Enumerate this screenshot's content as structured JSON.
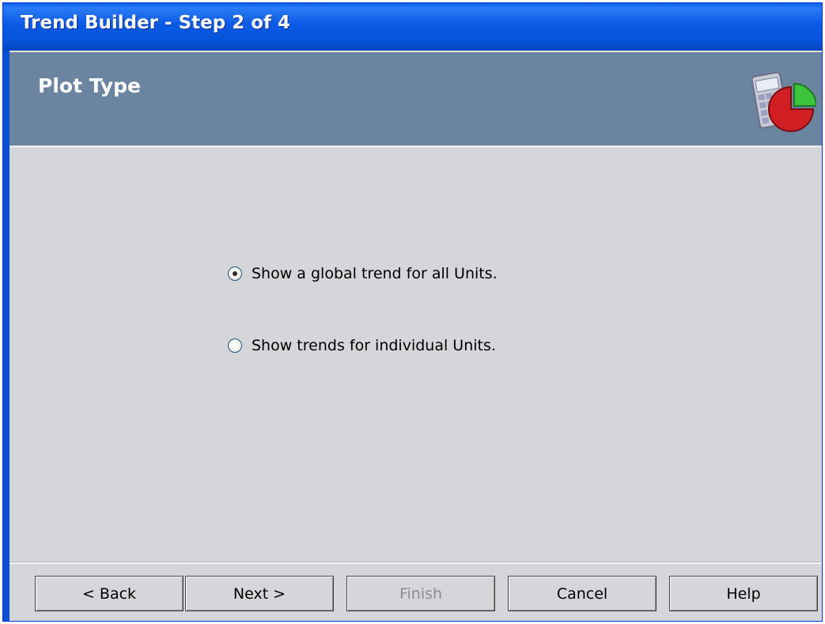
{
  "window": {
    "title": "Trend Builder - Step 2 of 4"
  },
  "header": {
    "heading": "Plot Type",
    "logo_icon": "calculator-pie-chart-icon"
  },
  "options": [
    {
      "label": "Show a global trend for all Units.",
      "checked": true
    },
    {
      "label": "Show trends for individual Units.",
      "checked": false
    }
  ],
  "buttons": {
    "back": "< Back",
    "next": "Next >",
    "finish": "Finish",
    "cancel": "Cancel",
    "help": "Help"
  },
  "colors": {
    "title_bar": "#0a5ae6",
    "header_band": "#6b84a0",
    "content_bg": "#d4d6d9"
  }
}
